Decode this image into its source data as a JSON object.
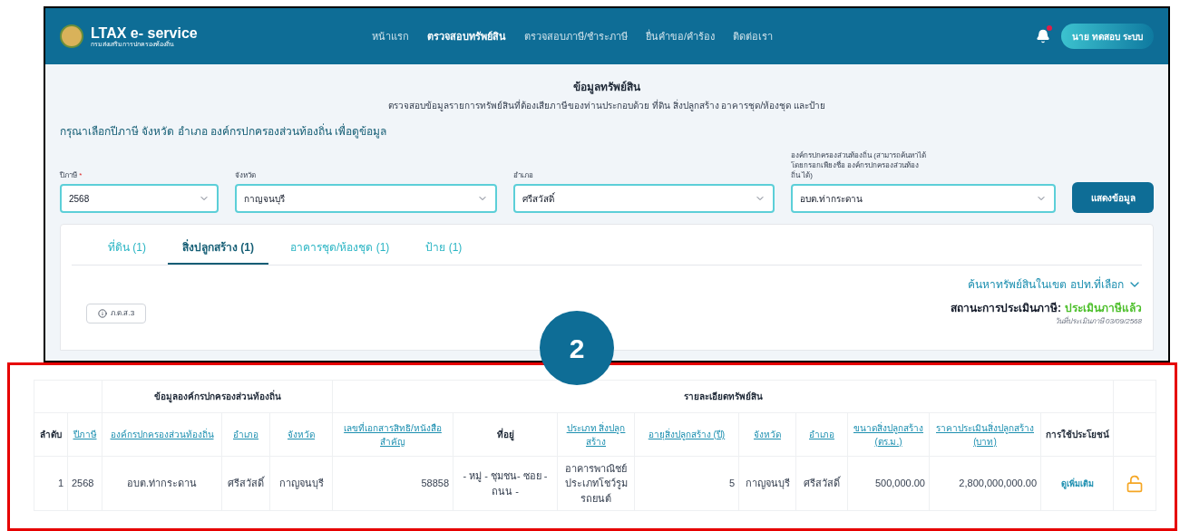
{
  "header": {
    "logo_title": "LTAX e- service",
    "logo_subtitle": "กรมส่งเสริมการปกครองท้องถิ่น",
    "nav": [
      {
        "label": "หน้าแรก",
        "selected": false
      },
      {
        "label": "ตรวจสอบทรัพย์สิน",
        "selected": true
      },
      {
        "label": "ตรวจสอบภาษี/ชำระภาษี",
        "selected": false
      },
      {
        "label": "ยื่นคำขอ/คำร้อง",
        "selected": false
      },
      {
        "label": "ติดต่อเรา",
        "selected": false
      }
    ],
    "notification_unread": true,
    "user": "นาย ทดสอบ ระบบ"
  },
  "page": {
    "title": "ข้อมูลทรัพย์สิน",
    "subtitle": "ตรวจสอบข้อมูลรายการทรัพย์สินที่ต้องเสียภาษีของท่านประกอบด้วย ที่ดิน สิ่งปลูกสร้าง อาคารชุด/ห้องชุด และป้าย",
    "prompt": "กรุณาเลือกปีภาษี จังหวัด อำเภอ องค์กรปกครองส่วนท้องถิ่น เพื่อดูข้อมูล"
  },
  "filters": [
    {
      "label": "ปีภาษี",
      "required_mark": "*",
      "value": "2568"
    },
    {
      "label": "จังหวัด",
      "value": "กาญจนบุรี"
    },
    {
      "label": "อำเภอ",
      "value": "ศรีสวัสดิ์"
    },
    {
      "label": "องค์กรปกครองส่วนท้องถิ่น (สามารถค้นหาได้โดยกรอกเพียงชื่อ องค์กรปกครองส่วนท้องถิ่น ได้)",
      "value": "อบต.ท่ากระดาน"
    }
  ],
  "show_button": "แสดงข้อมูล",
  "tabs": [
    {
      "label": "ที่ดิน (1)",
      "selected": false
    },
    {
      "label": "สิ่งปลูกสร้าง (1)",
      "selected": true
    },
    {
      "label": "อาคารชุด/ห้องชุด (1)",
      "selected": false
    },
    {
      "label": "ป้าย (1)",
      "selected": false
    }
  ],
  "search_link": "ค้นหาทรัพย์สินในเขต อปท.ที่เลือก",
  "form_button": "ภ.ด.ส.3",
  "status": {
    "label": "สถานะการประเมินภาษี:",
    "value": "ประเมินภาษีแล้ว",
    "date": "วันที่ประเมินภาษี 03/09/2568"
  },
  "callout": "2",
  "table": {
    "groups": [
      {
        "columns": [
          {
            "label": "ลำดับ",
            "sortable": false
          },
          {
            "label": "ปีภาษี",
            "sortable": true
          }
        ]
      },
      {
        "title": "ข้อมูลองค์กรปกครองส่วนท้องถิ่น",
        "columns": [
          {
            "label": "องค์กรปกครองส่วนท้องถิ่น",
            "sortable": true
          },
          {
            "label": "อำเภอ",
            "sortable": true
          },
          {
            "label": "จังหวัด",
            "sortable": true
          }
        ]
      },
      {
        "title": "รายละเอียดทรัพย์สิน",
        "columns": [
          {
            "label": "เลขที่เอกสารสิทธิ/หนังสือสำคัญ",
            "sortable": true
          },
          {
            "label": "ที่อยู่",
            "sortable": false
          },
          {
            "label": "ประเภท สิ่งปลูกสร้าง",
            "sortable": true
          },
          {
            "label": "อายุสิ่งปลูกสร้าง (ปี)",
            "sortable": true
          },
          {
            "label": "จังหวัด",
            "sortable": true
          },
          {
            "label": "อำเภอ",
            "sortable": true
          },
          {
            "label": "ขนาดสิ่งปลูกสร้าง (ตร.ม.)",
            "sortable": true
          },
          {
            "label": "ราคาประเมินสิ่งปลูกสร้าง (บาท)",
            "sortable": true
          },
          {
            "label": "การใช้ประโยชน์",
            "sortable": false
          }
        ]
      },
      {
        "columns": [
          {}
        ]
      }
    ],
    "rows": [
      [
        {
          "kind": "text",
          "text": "1"
        },
        {
          "kind": "text",
          "text": "2568"
        },
        {
          "kind": "text",
          "text": "อบต.ท่ากระดาน"
        },
        {
          "kind": "text",
          "text": "ศรีสวัสดิ์"
        },
        {
          "kind": "text",
          "text": "กาญจนบุรี"
        },
        {
          "kind": "text",
          "text": "58858"
        },
        {
          "kind": "text",
          "text": "- หมู่ - ชุมชน- ซอย - ถนน -"
        },
        {
          "kind": "text",
          "text": "อาคารพาณิชย์ ประเภทโชว์รูม รถยนต์"
        },
        {
          "kind": "text",
          "text": "5"
        },
        {
          "kind": "text",
          "text": "กาญจนบุรี"
        },
        {
          "kind": "text",
          "text": "ศรีสวัสดิ์"
        },
        {
          "kind": "text",
          "text": "500,000.00"
        },
        {
          "kind": "text",
          "text": "2,800,000,000.00"
        },
        {
          "kind": "link",
          "text": "ดูเพิ่มเติม"
        },
        {
          "kind": "lock"
        }
      ]
    ]
  }
}
